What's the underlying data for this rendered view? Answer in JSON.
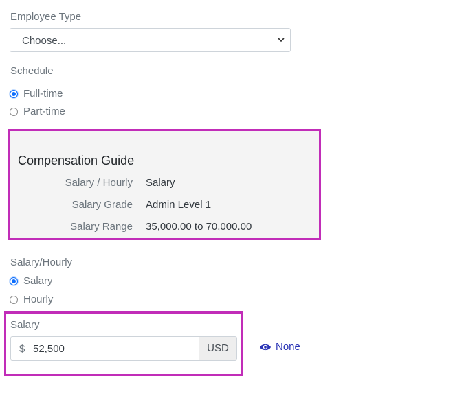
{
  "employee_type": {
    "label": "Employee Type",
    "selected": "Choose..."
  },
  "schedule": {
    "label": "Schedule",
    "options": [
      {
        "label": "Full-time",
        "checked": true
      },
      {
        "label": "Part-time",
        "checked": false
      }
    ]
  },
  "compensation_guide": {
    "title": "Compensation Guide",
    "rows": [
      {
        "key": "Salary / Hourly",
        "value": "Salary"
      },
      {
        "key": "Salary Grade",
        "value": "Admin Level 1"
      },
      {
        "key": "Salary Range",
        "value": "35,000.00 to 70,000.00"
      }
    ]
  },
  "salary_hourly": {
    "label": "Salary/Hourly",
    "options": [
      {
        "label": "Salary",
        "checked": true
      },
      {
        "label": "Hourly",
        "checked": false
      }
    ]
  },
  "salary": {
    "label": "Salary",
    "currency_symbol": "$",
    "value": "52,500",
    "currency_code": "USD",
    "view_link": "None",
    "view_icon": "eye-icon"
  },
  "colors": {
    "highlight_border": "#c12db8",
    "radio_accent": "#0d6efd",
    "link": "#2a34b5"
  }
}
